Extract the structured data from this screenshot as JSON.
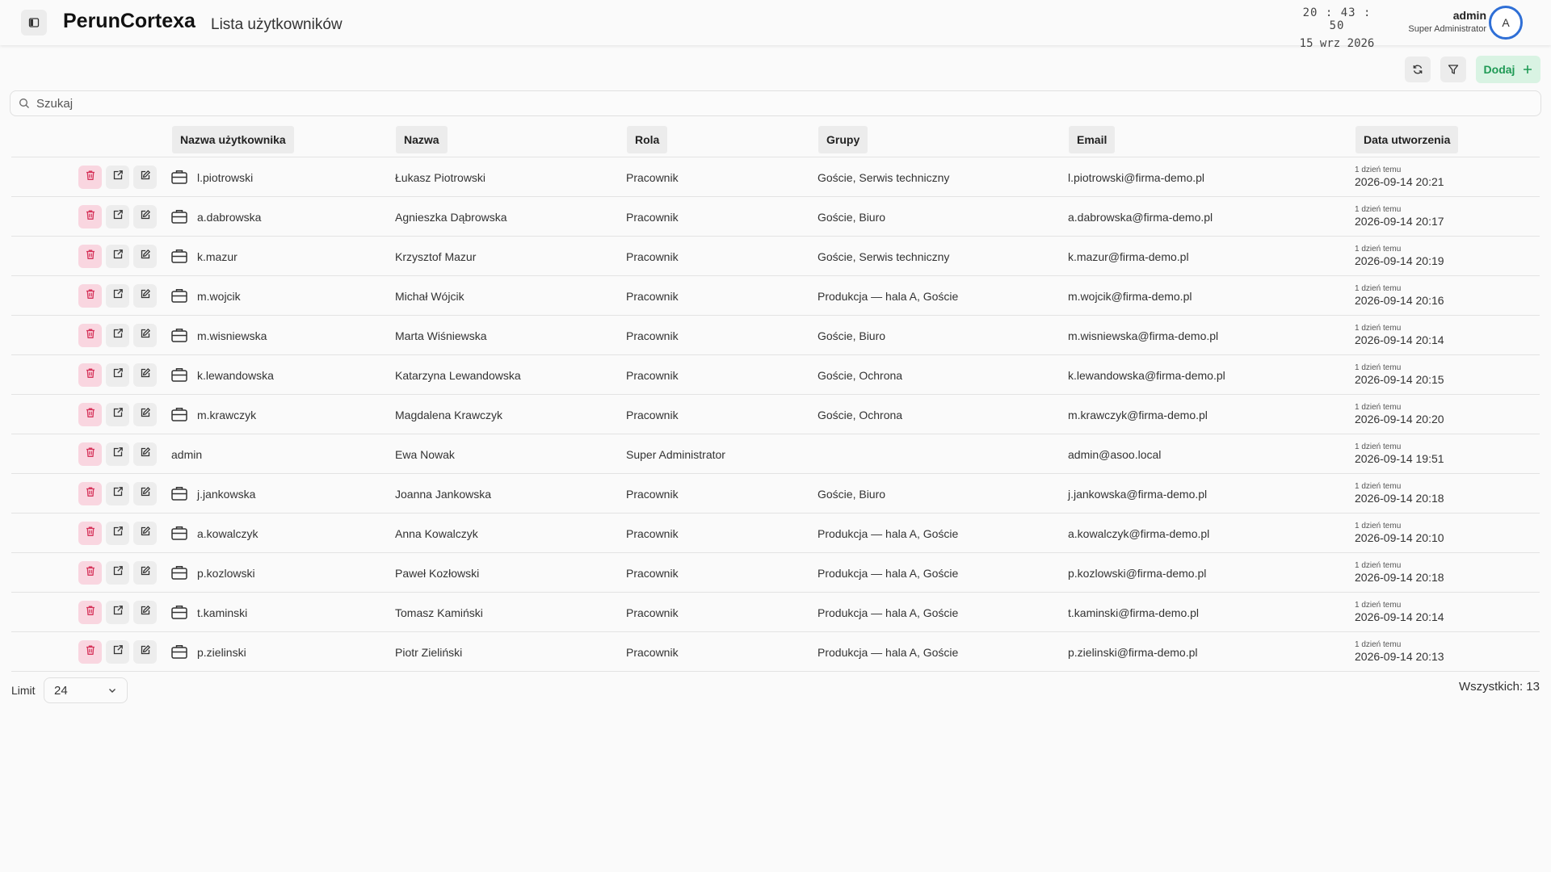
{
  "header": {
    "app_title": "PerunCortexa",
    "page_title": "Lista użytkowników",
    "clock_time": "20 : 43 : 50",
    "clock_date": "15 wrz 2026",
    "user_name": "admin",
    "user_role": "Super Administrator",
    "avatar_initial": "A"
  },
  "toolbar": {
    "add_label": "Dodaj"
  },
  "search": {
    "placeholder": "Szukaj"
  },
  "table": {
    "columns": [
      "Nazwa użytkownika",
      "Nazwa",
      "Rola",
      "Grupy",
      "Email",
      "Data utworzenia"
    ],
    "rows": [
      {
        "username": "l.piotrowski",
        "name": "Łukasz Piotrowski",
        "role": "Pracownik",
        "groups": "Goście, Serwis techniczny",
        "email": "l.piotrowski@firma-demo.pl",
        "created_rel": "1 dzień temu",
        "created": "2026-09-14 20:21",
        "icon": true
      },
      {
        "username": "a.dabrowska",
        "name": "Agnieszka Dąbrowska",
        "role": "Pracownik",
        "groups": "Goście, Biuro",
        "email": "a.dabrowska@firma-demo.pl",
        "created_rel": "1 dzień temu",
        "created": "2026-09-14 20:17",
        "icon": true
      },
      {
        "username": "k.mazur",
        "name": "Krzysztof Mazur",
        "role": "Pracownik",
        "groups": "Goście, Serwis techniczny",
        "email": "k.mazur@firma-demo.pl",
        "created_rel": "1 dzień temu",
        "created": "2026-09-14 20:19",
        "icon": true
      },
      {
        "username": "m.wojcik",
        "name": "Michał Wójcik",
        "role": "Pracownik",
        "groups": "Produkcja — hala A, Goście",
        "email": "m.wojcik@firma-demo.pl",
        "created_rel": "1 dzień temu",
        "created": "2026-09-14 20:16",
        "icon": true
      },
      {
        "username": "m.wisniewska",
        "name": "Marta Wiśniewska",
        "role": "Pracownik",
        "groups": "Goście, Biuro",
        "email": "m.wisniewska@firma-demo.pl",
        "created_rel": "1 dzień temu",
        "created": "2026-09-14 20:14",
        "icon": true
      },
      {
        "username": "k.lewandowska",
        "name": "Katarzyna Lewandowska",
        "role": "Pracownik",
        "groups": "Goście, Ochrona",
        "email": "k.lewandowska@firma-demo.pl",
        "created_rel": "1 dzień temu",
        "created": "2026-09-14 20:15",
        "icon": true
      },
      {
        "username": "m.krawczyk",
        "name": "Magdalena Krawczyk",
        "role": "Pracownik",
        "groups": "Goście, Ochrona",
        "email": "m.krawczyk@firma-demo.pl",
        "created_rel": "1 dzień temu",
        "created": "2026-09-14 20:20",
        "icon": true
      },
      {
        "username": "admin",
        "name": "Ewa Nowak",
        "role": "Super Administrator",
        "groups": "",
        "email": "admin@asoo.local",
        "created_rel": "1 dzień temu",
        "created": "2026-09-14 19:51",
        "icon": false
      },
      {
        "username": "j.jankowska",
        "name": "Joanna Jankowska",
        "role": "Pracownik",
        "groups": "Goście, Biuro",
        "email": "j.jankowska@firma-demo.pl",
        "created_rel": "1 dzień temu",
        "created": "2026-09-14 20:18",
        "icon": true
      },
      {
        "username": "a.kowalczyk",
        "name": "Anna Kowalczyk",
        "role": "Pracownik",
        "groups": "Produkcja — hala A, Goście",
        "email": "a.kowalczyk@firma-demo.pl",
        "created_rel": "1 dzień temu",
        "created": "2026-09-14 20:10",
        "icon": true
      },
      {
        "username": "p.kozlowski",
        "name": "Paweł Kozłowski",
        "role": "Pracownik",
        "groups": "Produkcja — hala A, Goście",
        "email": "p.kozlowski@firma-demo.pl",
        "created_rel": "1 dzień temu",
        "created": "2026-09-14 20:18",
        "icon": true
      },
      {
        "username": "t.kaminski",
        "name": "Tomasz Kamiński",
        "role": "Pracownik",
        "groups": "Produkcja — hala A, Goście",
        "email": "t.kaminski@firma-demo.pl",
        "created_rel": "1 dzień temu",
        "created": "2026-09-14 20:14",
        "icon": true
      },
      {
        "username": "p.zielinski",
        "name": "Piotr Zieliński",
        "role": "Pracownik",
        "groups": "Produkcja — hala A, Goście",
        "email": "p.zielinski@firma-demo.pl",
        "created_rel": "1 dzień temu",
        "created": "2026-09-14 20:13",
        "icon": true
      }
    ]
  },
  "footer": {
    "limit_label": "Limit",
    "limit_value": "24",
    "total": "Wszystkich: 13"
  },
  "icons": {
    "sidebar_toggle": "sidebar-toggle-icon",
    "refresh": "refresh-icon",
    "filter": "filter-icon",
    "add": "plus-icon",
    "search": "search-icon",
    "delete": "trash-icon",
    "open": "external-link-icon",
    "edit": "edit-icon",
    "user_type": "briefcase-icon",
    "select": "chevron-down-icon"
  },
  "colors": {
    "accent": "#2f6fd6",
    "add_bg": "#d9f3e3",
    "add_text": "#1f9a55",
    "delete_bg": "#f9d6e0",
    "delete_icon": "#d6335a"
  }
}
